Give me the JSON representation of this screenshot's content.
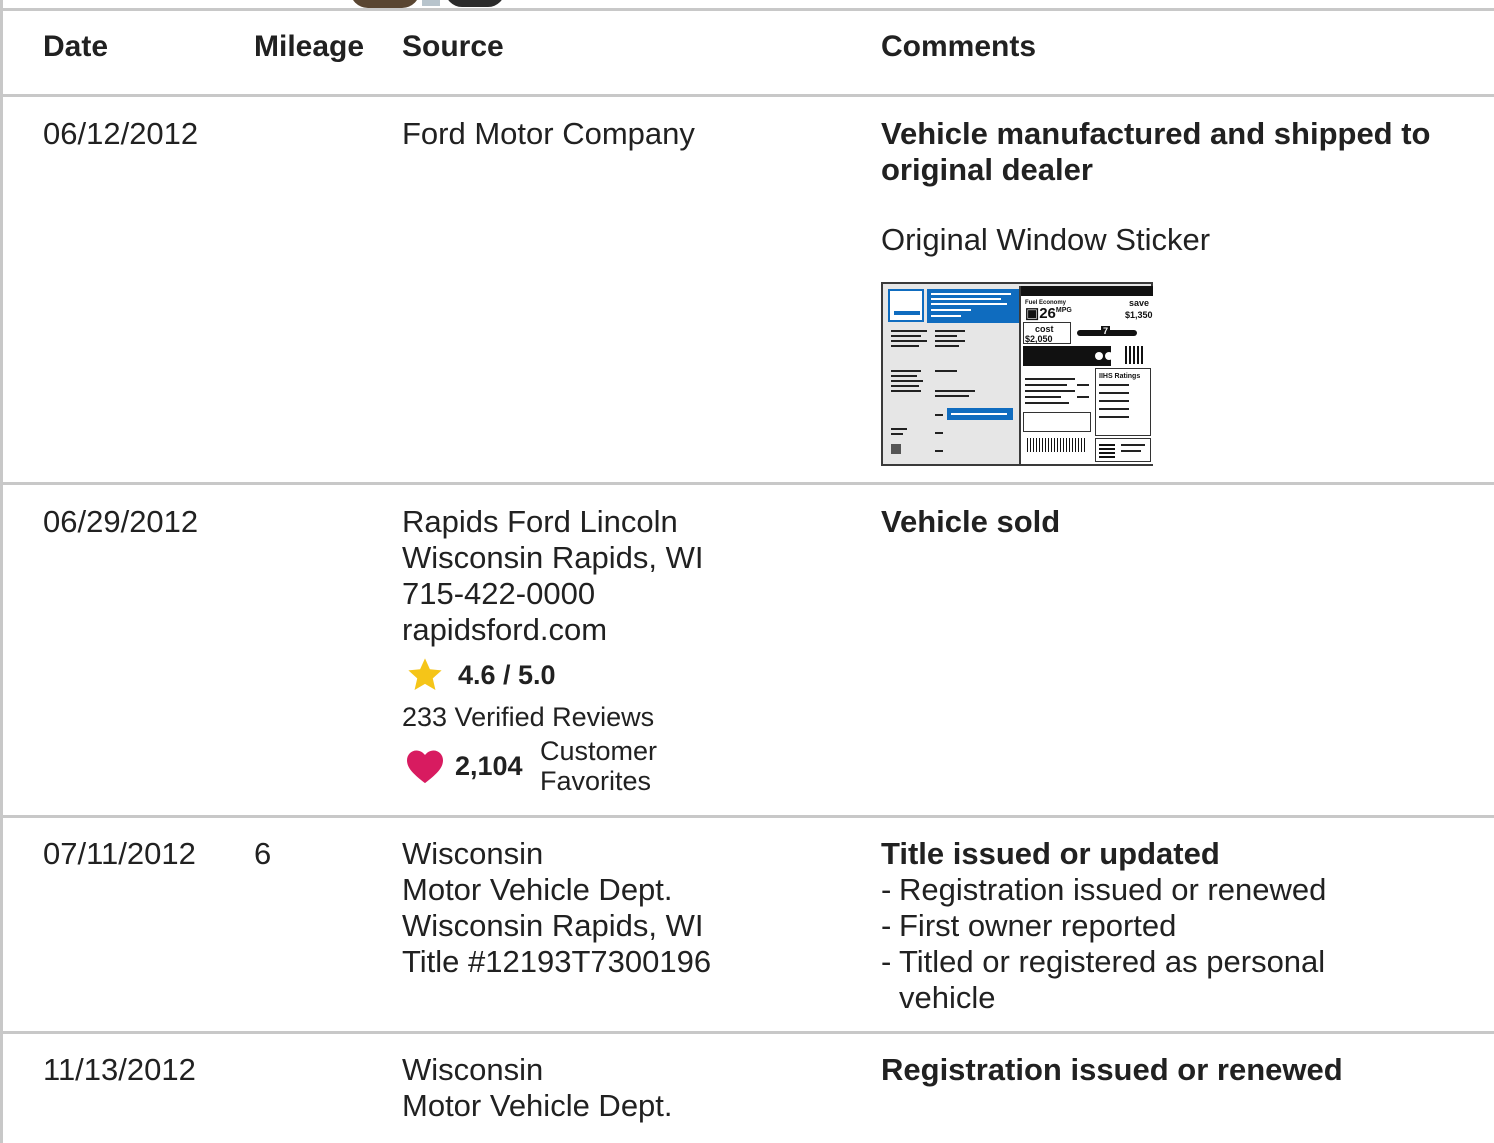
{
  "header": {
    "date": "Date",
    "mileage": "Mileage",
    "source": "Source",
    "comments": "Comments"
  },
  "records": [
    {
      "date": "06/12/2012",
      "mileage": "",
      "source": [
        "Ford Motor Company"
      ],
      "comment_title": "Vehicle manufactured and shipped to original dealer",
      "comment_link": "Original Window Sticker",
      "sticker": {
        "mpg": "26",
        "mpg_unit": "MPG",
        "save_label": "save",
        "save_value": "$1,350",
        "cost_label": "cost",
        "cost_value": "$2,050",
        "rating_box": "7",
        "iihs_label": "IIHS Ratings"
      }
    },
    {
      "date": "06/29/2012",
      "mileage": "",
      "source": [
        "Rapids Ford Lincoln",
        "Wisconsin Rapids, WI",
        "715-422-0000",
        "rapidsford.com"
      ],
      "rating": "4.6 / 5.0",
      "reviews": "233 Verified Reviews",
      "favorites_count": "2,104",
      "favorites_label_1": "Customer",
      "favorites_label_2": "Favorites",
      "comment_title": "Vehicle sold"
    },
    {
      "date": "07/11/2012",
      "mileage": "6",
      "source": [
        "Wisconsin",
        "Motor Vehicle Dept.",
        "Wisconsin Rapids, WI",
        "Title #12193T7300196"
      ],
      "comment_title": "Title issued or updated",
      "bullets": [
        "Registration issued or renewed",
        "First owner reported",
        "Titled or registered as personal",
        "vehicle"
      ]
    },
    {
      "date": "11/13/2012",
      "mileage": "",
      "source": [
        "Wisconsin",
        "Motor Vehicle Dept."
      ],
      "comment_title": "Registration issued or renewed"
    }
  ],
  "colors": {
    "star": "#f5c518",
    "heart": "#d81b60",
    "sticker_blue": "#0f6cbf",
    "rule": "#c8c8c8"
  }
}
